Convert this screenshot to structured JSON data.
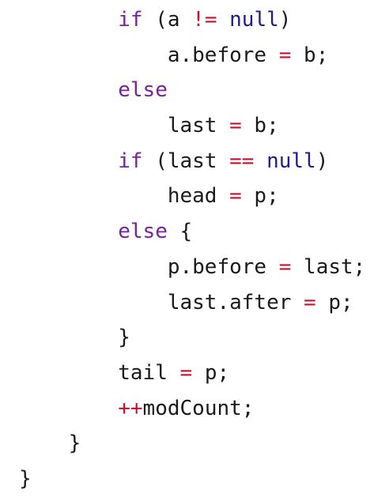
{
  "colors": {
    "keyword": "#7a1fa2",
    "literal": "#1c1c8c",
    "operator": "#c8102e",
    "text": "#1a1a1a",
    "background": "#ffffff"
  },
  "code": {
    "lines": [
      {
        "indent": "        ",
        "tokens": [
          {
            "t": "kw",
            "v": "if"
          },
          {
            "t": "plain",
            "v": " (a "
          },
          {
            "t": "op",
            "v": "!="
          },
          {
            "t": "plain",
            "v": " "
          },
          {
            "t": "lit",
            "v": "null"
          },
          {
            "t": "plain",
            "v": ")"
          }
        ]
      },
      {
        "indent": "            ",
        "tokens": [
          {
            "t": "plain",
            "v": "a.before "
          },
          {
            "t": "op",
            "v": "="
          },
          {
            "t": "plain",
            "v": " b;"
          }
        ]
      },
      {
        "indent": "        ",
        "tokens": [
          {
            "t": "kw",
            "v": "else"
          }
        ]
      },
      {
        "indent": "            ",
        "tokens": [
          {
            "t": "plain",
            "v": "last "
          },
          {
            "t": "op",
            "v": "="
          },
          {
            "t": "plain",
            "v": " b;"
          }
        ]
      },
      {
        "indent": "        ",
        "tokens": [
          {
            "t": "kw",
            "v": "if"
          },
          {
            "t": "plain",
            "v": " (last "
          },
          {
            "t": "op",
            "v": "=="
          },
          {
            "t": "plain",
            "v": " "
          },
          {
            "t": "lit",
            "v": "null"
          },
          {
            "t": "plain",
            "v": ")"
          }
        ]
      },
      {
        "indent": "            ",
        "tokens": [
          {
            "t": "plain",
            "v": "head "
          },
          {
            "t": "op",
            "v": "="
          },
          {
            "t": "plain",
            "v": " p;"
          }
        ]
      },
      {
        "indent": "        ",
        "tokens": [
          {
            "t": "kw",
            "v": "else"
          },
          {
            "t": "plain",
            "v": " {"
          }
        ]
      },
      {
        "indent": "            ",
        "tokens": [
          {
            "t": "plain",
            "v": "p.before "
          },
          {
            "t": "op",
            "v": "="
          },
          {
            "t": "plain",
            "v": " last;"
          }
        ]
      },
      {
        "indent": "            ",
        "tokens": [
          {
            "t": "plain",
            "v": "last.after "
          },
          {
            "t": "op",
            "v": "="
          },
          {
            "t": "plain",
            "v": " p;"
          }
        ]
      },
      {
        "indent": "        ",
        "tokens": [
          {
            "t": "plain",
            "v": "}"
          }
        ]
      },
      {
        "indent": "        ",
        "tokens": [
          {
            "t": "plain",
            "v": "tail "
          },
          {
            "t": "op",
            "v": "="
          },
          {
            "t": "plain",
            "v": " p;"
          }
        ]
      },
      {
        "indent": "        ",
        "tokens": [
          {
            "t": "op",
            "v": "++"
          },
          {
            "t": "plain",
            "v": "modCount;"
          }
        ]
      },
      {
        "indent": "    ",
        "tokens": [
          {
            "t": "plain",
            "v": "}"
          }
        ]
      },
      {
        "indent": "",
        "tokens": [
          {
            "t": "plain",
            "v": "}"
          }
        ]
      }
    ]
  }
}
